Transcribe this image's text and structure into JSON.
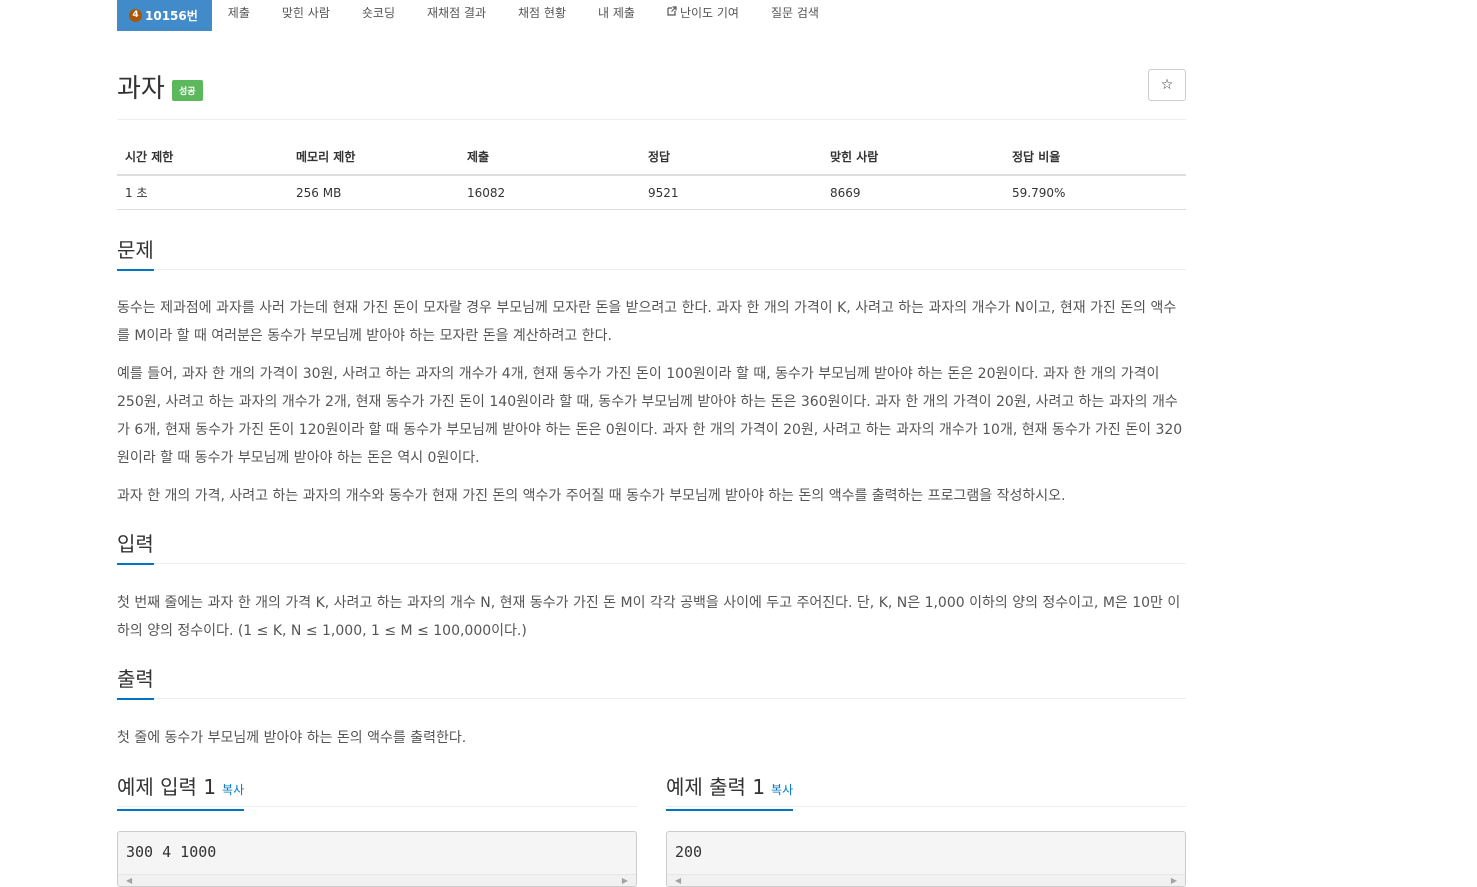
{
  "menu": {
    "problem_tier": "4",
    "problem_number": "10156번",
    "items": [
      "제출",
      "맞힌 사람",
      "숏코딩",
      "재채점 결과",
      "채점 현황",
      "내 제출",
      "난이도 기여",
      "질문 검색"
    ]
  },
  "title": "과자",
  "status_label": "성공",
  "star_glyph": "☆",
  "info": {
    "headers": [
      "시간 제한",
      "메모리 제한",
      "제출",
      "정답",
      "맞힌 사람",
      "정답 비율"
    ],
    "values": [
      "1 초",
      "256 MB",
      "16082",
      "9521",
      "8669",
      "59.790%"
    ]
  },
  "sections": {
    "problem": {
      "heading": "문제",
      "paragraphs": [
        "동수는 제과점에 과자를 사러 가는데 현재 가진 돈이 모자랄 경우 부모님께 모자란 돈을 받으려고 한다. 과자 한 개의 가격이 K, 사려고 하는 과자의 개수가 N이고, 현재 가진 돈의 액수를 M이라 할 때 여러분은 동수가 부모님께 받아야 하는 모자란 돈을 계산하려고 한다.",
        "예를 들어, 과자 한 개의 가격이 30원, 사려고 하는 과자의 개수가 4개, 현재 동수가 가진 돈이 100원이라 할 때, 동수가 부모님께 받아야 하는 돈은 20원이다. 과자 한 개의 가격이 250원, 사려고 하는 과자의 개수가 2개, 현재 동수가 가진 돈이 140원이라 할 때, 동수가 부모님께 받아야 하는 돈은 360원이다. 과자 한 개의 가격이 20원, 사려고 하는 과자의 개수가 6개, 현재 동수가 가진 돈이 120원이라 할 때 동수가 부모님께 받아야 하는 돈은 0원이다. 과자 한 개의 가격이 20원, 사려고 하는 과자의 개수가 10개, 현재 동수가 가진 돈이 320원이라 할 때 동수가 부모님께 받아야 하는 돈은 역시 0원이다.",
        "과자 한 개의 가격, 사려고 하는 과자의 개수와 동수가 현재 가진 돈의 액수가 주어질 때 동수가 부모님께 받아야 하는 돈의 액수를 출력하는 프로그램을 작성하시오."
      ]
    },
    "input": {
      "heading": "입력",
      "paragraphs": [
        "첫 번째 줄에는 과자 한 개의 가격 K, 사려고 하는 과자의 개수 N, 현재 동수가 가진 돈 M이 각각 공백을 사이에 두고 주어진다. 단, K, N은 1,000 이하의 양의 정수이고, M은 10만 이하의 양의 정수이다. (1 ≤ K, N ≤ 1,000, 1 ≤ M ≤ 100,000이다.)"
      ]
    },
    "output": {
      "heading": "출력",
      "paragraphs": [
        "첫 줄에 동수가 부모님께 받아야 하는 돈의 액수를 출력한다."
      ]
    }
  },
  "samples": {
    "input": {
      "heading": "예제 입력 1",
      "copy_label": "복사",
      "content": "300 4 1000"
    },
    "output": {
      "heading": "예제 출력 1",
      "copy_label": "복사",
      "content": "200"
    }
  }
}
